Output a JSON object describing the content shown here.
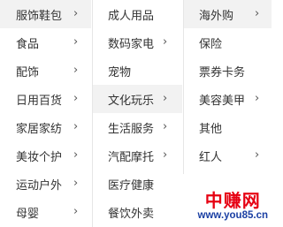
{
  "menu": {
    "level1": [
      {
        "label": "服饰鞋包",
        "chevron": "›"
      },
      {
        "label": "食品",
        "chevron": "›"
      },
      {
        "label": "配饰",
        "chevron": "›"
      },
      {
        "label": "日用百货",
        "chevron": "›"
      },
      {
        "label": "家居家纺",
        "chevron": "›"
      },
      {
        "label": "美妆个护",
        "chevron": "›"
      },
      {
        "label": "运动户外",
        "chevron": "›"
      },
      {
        "label": "母婴",
        "chevron": "›"
      }
    ],
    "level2": [
      {
        "label": "成人用品",
        "chevron": ""
      },
      {
        "label": "数码家电",
        "chevron": "›"
      },
      {
        "label": "宠物",
        "chevron": ""
      },
      {
        "label": "文化玩乐",
        "chevron": "›"
      },
      {
        "label": "生活服务",
        "chevron": "›"
      },
      {
        "label": "汽配摩托",
        "chevron": "›"
      },
      {
        "label": "医疗健康",
        "chevron": ""
      },
      {
        "label": "餐饮外卖",
        "chevron": ""
      }
    ],
    "level3": [
      {
        "label": "海外购",
        "chevron": "›"
      },
      {
        "label": "保险",
        "chevron": ""
      },
      {
        "label": "票券卡务",
        "chevron": ""
      },
      {
        "label": "美容美甲",
        "chevron": "›"
      },
      {
        "label": "其他",
        "chevron": ""
      },
      {
        "label": "红人",
        "chevron": "›"
      }
    ]
  },
  "watermark": {
    "name": "中赚网",
    "url": "www.you85.cn"
  },
  "colors": {
    "active_bg": "#f2f2f2",
    "divider": "#e6e6e6",
    "text": "#333333",
    "watermark_red": "#e60012",
    "watermark_blue": "#1a3fa3"
  }
}
